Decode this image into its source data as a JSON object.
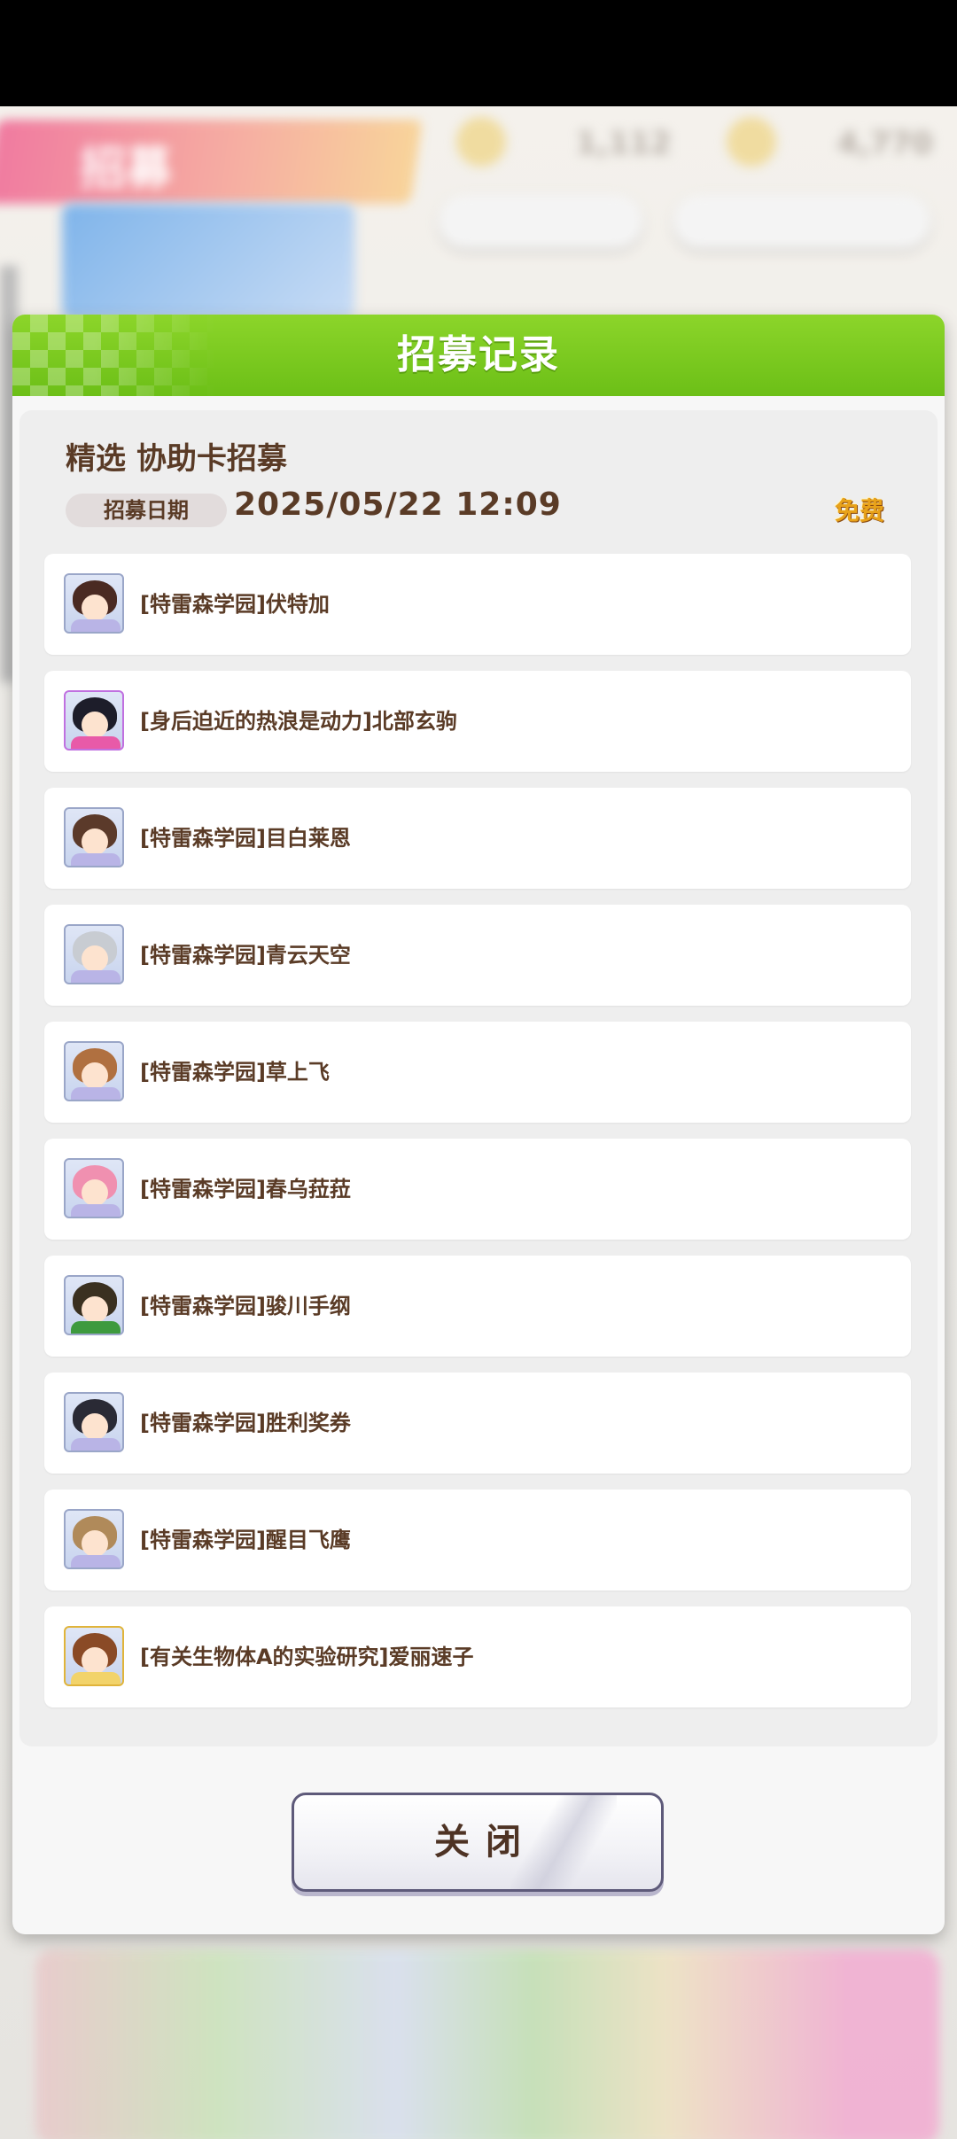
{
  "modal": {
    "title": "招募记录",
    "pull_title": "精选  协助卡招募",
    "date_label": "招募日期",
    "date_value": "2025/05/22  12:09",
    "cost_badge": "免费",
    "records": [
      {
        "name": "[特雷森学园]伏特加",
        "hair": "#4a2a22",
        "body": "#b9b4e6"
      },
      {
        "name": "[身后迫近的热浪是动力]北部玄驹",
        "hair": "#1d1d2a",
        "body": "#e85aa8"
      },
      {
        "name": "[特雷森学园]目白莱恩",
        "hair": "#5b3a2a",
        "body": "#b9b4e6"
      },
      {
        "name": "[特雷森学园]青云天空",
        "hair": "#c8ccd2",
        "body": "#b9b4e6"
      },
      {
        "name": "[特雷森学园]草上飞",
        "hair": "#b07040",
        "body": "#b9b4e6"
      },
      {
        "name": "[特雷森学园]春乌菈菈",
        "hair": "#f090b0",
        "body": "#b9b4e6"
      },
      {
        "name": "[特雷森学园]骏川手纲",
        "hair": "#3a3020",
        "body": "#3e9a3e"
      },
      {
        "name": "[特雷森学园]胜利奖券",
        "hair": "#2a2a35",
        "body": "#b9b4e6"
      },
      {
        "name": "[特雷森学园]醒目飞鹰",
        "hair": "#b08a5a",
        "body": "#b9b4e6"
      },
      {
        "name": "[有关生物体A的实验研究]爱丽速子",
        "hair": "#8a4a26",
        "body": "#f2d36a"
      }
    ],
    "close_label": "关闭"
  },
  "background": {
    "banner_text": "招募",
    "currency_1": "1,112",
    "currency_2": "4,770"
  }
}
